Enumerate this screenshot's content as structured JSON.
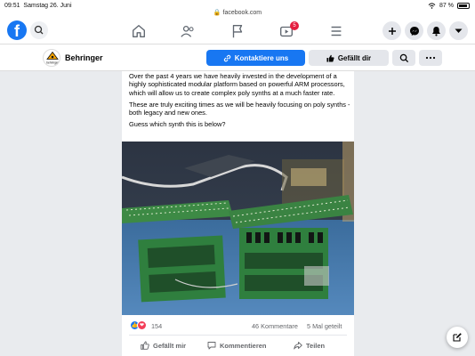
{
  "status_bar": {
    "time": "09:51",
    "date": "Samstag 26. Juni",
    "url": "facebook.com",
    "battery_label": "87 %",
    "battery_level": 0.87
  },
  "nav": {
    "notification_badge": "5"
  },
  "page": {
    "name": "Behringer",
    "avatar_text": "behringer",
    "contact_label": "Kontaktiere uns",
    "like_label": "Gefällt dir"
  },
  "post": {
    "paragraphs": [
      "Over the past 4 years we have heavily invested in the development of a highly sophisticated modular platform based on powerful ARM processors, which will allow us to create complex poly synths at a much faster rate.",
      "These are truly exciting times as we will be heavily focusing on poly synths - both legacy and new ones.",
      "Guess which synth this is below?"
    ],
    "like_count": "154",
    "comments": "46 Kommentare",
    "shares": "5 Mal geteilt",
    "actions": {
      "like": "Gefällt mir",
      "comment": "Kommentieren",
      "share": "Teilen"
    }
  },
  "colors": {
    "brand": "#1877f2",
    "badge": "#e41e3f",
    "love": "#f33e58"
  },
  "icons": [
    "facebook-logo-icon",
    "search-icon",
    "home-icon",
    "friends-icon",
    "flag-icon",
    "video-icon",
    "menu-icon",
    "plus-icon",
    "messenger-icon",
    "bell-icon",
    "chevron-down-icon",
    "link-icon",
    "thumbs-up-icon",
    "more-icon",
    "heart-icon",
    "comment-icon",
    "share-icon",
    "compose-icon",
    "wifi-icon",
    "lock-icon"
  ]
}
